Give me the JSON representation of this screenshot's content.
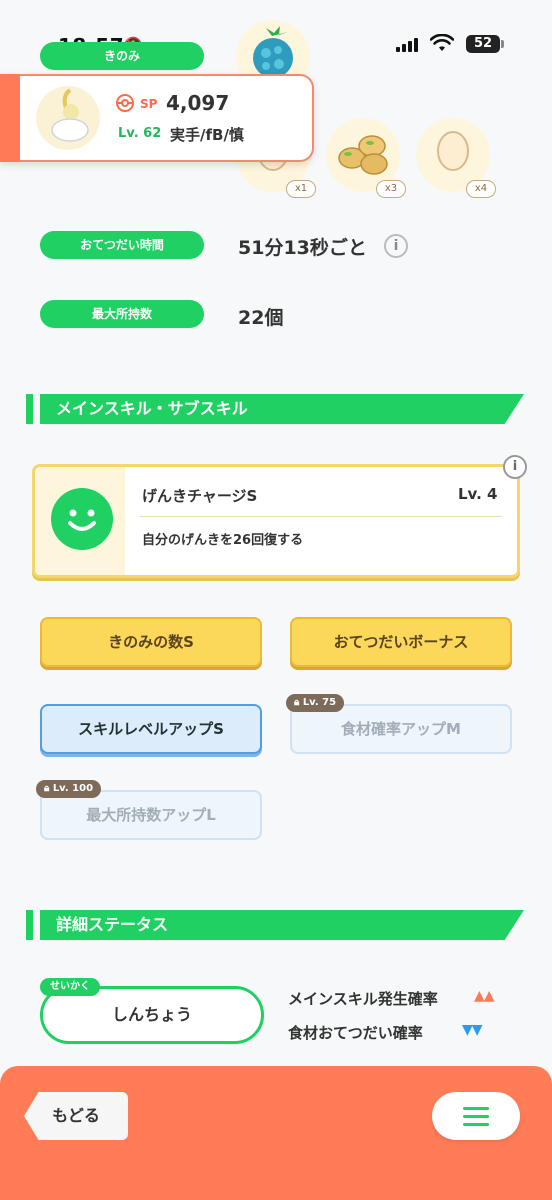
{
  "status_bar": {
    "time": "18:57",
    "battery": "52"
  },
  "labels": {
    "berry": "きのみ",
    "help_time": "おてつだい時間",
    "max_carry": "最大所持数"
  },
  "values": {
    "help_time": "51分13秒ごと",
    "max_carry": "22個"
  },
  "items": [
    {
      "name": "egg",
      "count": "x1"
    },
    {
      "name": "beans",
      "count": "x3"
    },
    {
      "name": "egg",
      "count": "x4"
    }
  ],
  "pokemon": {
    "sp_label": "SP",
    "sp_value": "4,097",
    "level": "Lv. 62",
    "nature_short": "実手/fB/慎"
  },
  "main_skill_section": {
    "title": "メインスキル・サブスキル"
  },
  "main_skill": {
    "name": "げんきチャージS",
    "level": "Lv. 4",
    "description": "自分のげんきを26回復する"
  },
  "sub_skills": [
    {
      "label": "きのみの数S",
      "style": "yellow"
    },
    {
      "label": "おてつだいボーナス",
      "style": "yellow"
    },
    {
      "label": "スキルレベルアップS",
      "style": "blue"
    },
    {
      "label": "食材確率アップM",
      "style": "locked",
      "lock": "Lv. 75"
    },
    {
      "label": "最大所持数アップL",
      "style": "locked",
      "lock": "Lv. 100"
    }
  ],
  "detail_section": {
    "title": "詳細ステータス"
  },
  "nature": {
    "tag": "せいかく",
    "name": "しんちょう",
    "up_label": "メインスキル発生確率",
    "up_marks": "▲▲",
    "down_label": "食材おてつだい確率",
    "down_marks": "▼▼"
  },
  "nav": {
    "back_label": "もどる"
  },
  "colors": {
    "accent_green": "#21d063",
    "nav_orange": "#ff7c56",
    "up": "#ff7a55",
    "down": "#2f9ae8"
  }
}
